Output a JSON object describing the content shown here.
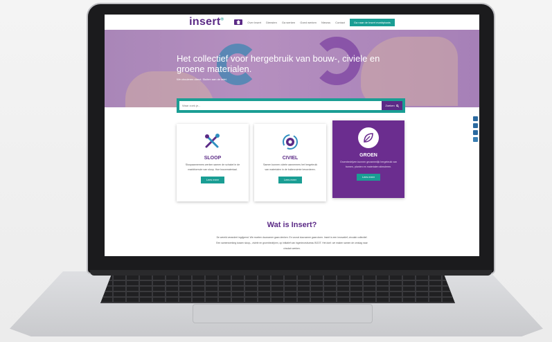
{
  "brand": {
    "logo": "insert",
    "mark": "®",
    "purple": "#5b2a86",
    "teal": "#1a9e94"
  },
  "nav": {
    "home_icon": "home-icon",
    "links": [
      "Over Insert",
      "Diensten",
      "Ga werken",
      "Goed werken",
      "Nieuws",
      "Contact"
    ],
    "cta": "Ga naar de Insert marktplaats"
  },
  "hero": {
    "title": "Het collectief voor hergebruik van bouw-, civiele en groene materialen.",
    "subtitle": "We circuleren direct. Sluiten aan de tafel."
  },
  "search": {
    "placeholder": "Waar zoek je...",
    "button": "Zoeken"
  },
  "cards": [
    {
      "title": "SLOOP",
      "text": "Sloopaannemers werken samen de schakel in de marktformule van sloop. Hoe bouwmateriaal.",
      "button": "Lees meer",
      "icon": "tools-icon"
    },
    {
      "title": "CIVIEL",
      "text": "Samen kunnen civiele aannemers het hergebruik van materialen in de buitenruimte bevorderen.",
      "button": "Lees meer",
      "icon": "gear-icon"
    },
    {
      "title": "GROEN",
      "text": "Groenbedrijven kunnen gezamenlijk hergebruik van bomen, planten en materialen stimuleren.",
      "button": "Lees meer",
      "icon": "leaf-icon"
    }
  ],
  "about": {
    "title": "Wat is Insert?",
    "text": "De wereld verandert ingrijpend. We moeten duurzamer gaan denken. En vooral duurzamer gaan doen. Insert is een innovatief, circulair collectief. Een samenwerking tussen sloop-, civiele en groenbedrijven, op initiatief van ingenieursbureau BOOT. Het doel: we maken samen de omslag naar circulair werken."
  },
  "social": [
    "linkedin-icon",
    "facebook-icon",
    "twitter-icon",
    "youtube-icon"
  ]
}
